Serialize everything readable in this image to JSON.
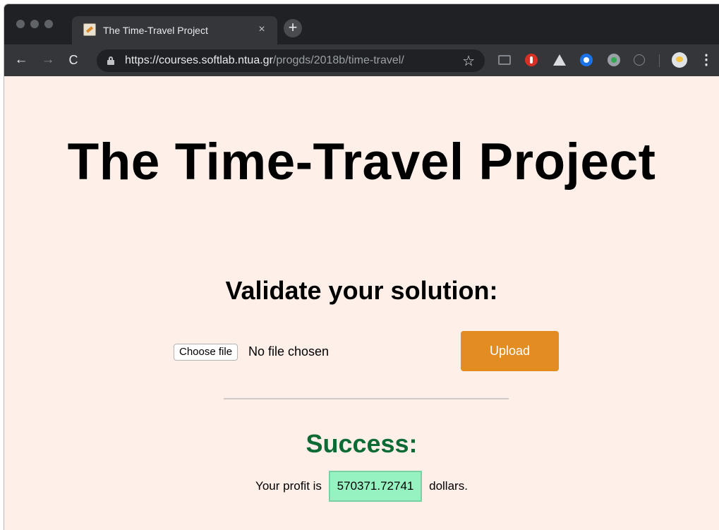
{
  "browser": {
    "tab": {
      "title": "The Time-Travel Project",
      "close": "×"
    },
    "new_tab": "+",
    "nav": {
      "back": "←",
      "forward": "→",
      "reload": "C"
    },
    "address": {
      "host": "https://courses.softlab.ntua.gr",
      "path": "/progds/2018b/time-travel/"
    },
    "star": "☆",
    "menu": "⋮",
    "extensions": [
      "cast-icon",
      "block-icon",
      "drive-icon",
      "blue-circle-icon",
      "green-dot-icon",
      "info-icon",
      "profile-avatar"
    ]
  },
  "page": {
    "title": "The Time-Travel Project",
    "validate_heading": "Validate your solution:",
    "file_input": {
      "button": "Choose file",
      "status": "No file chosen"
    },
    "upload_button": "Upload",
    "success_heading": "Success:",
    "profit": {
      "prefix": "Your profit is",
      "value": "570371.72741",
      "suffix": "dollars."
    }
  },
  "colors": {
    "page_background": "#ffefe9",
    "upload_button": "#e38c21",
    "success": "#0c6b34",
    "profit_highlight": "#96f3c1"
  }
}
